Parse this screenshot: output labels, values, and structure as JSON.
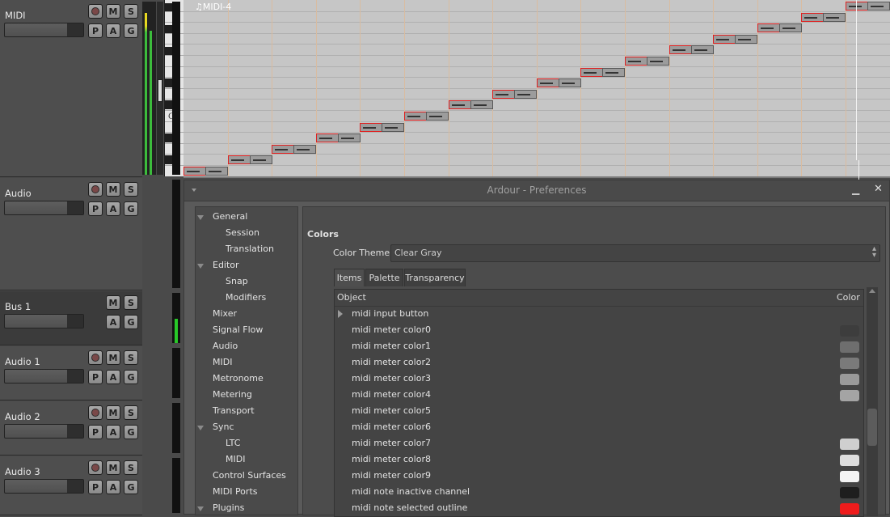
{
  "tracks": [
    {
      "name": "MIDI",
      "type": "midi",
      "buttons_top": [
        "M",
        "S"
      ],
      "buttons_bottom": [
        "P",
        "A",
        "G"
      ],
      "rec": true
    },
    {
      "name": "Audio",
      "type": "audio",
      "buttons_top": [
        "M",
        "S"
      ],
      "buttons_bottom": [
        "P",
        "A",
        "G"
      ],
      "rec": true
    },
    {
      "name": "Bus 1",
      "type": "bus",
      "buttons_top": [
        "M",
        "S"
      ],
      "buttons_bottom": [
        "A",
        "G"
      ],
      "rec": false
    },
    {
      "name": "Audio 1",
      "type": "audio",
      "buttons_top": [
        "M",
        "S"
      ],
      "buttons_bottom": [
        "P",
        "A",
        "G"
      ],
      "rec": true
    },
    {
      "name": "Audio 2",
      "type": "audio",
      "buttons_top": [
        "M",
        "S"
      ],
      "buttons_bottom": [
        "P",
        "A",
        "G"
      ],
      "rec": true
    },
    {
      "name": "Audio 3",
      "type": "audio",
      "buttons_top": [
        "M",
        "S"
      ],
      "buttons_bottom": [
        "P",
        "A",
        "G"
      ],
      "rec": true
    }
  ],
  "piano_roll": {
    "region_name": "♫MIDI-4",
    "key_label": "C4",
    "note_count": 16
  },
  "dialog": {
    "title": "Ardour - Preferences",
    "minimize_glyph": "▁",
    "close_glyph": "✕",
    "sidebar": [
      {
        "label": "General",
        "level": 0,
        "expanded": true
      },
      {
        "label": "Session",
        "level": 1
      },
      {
        "label": "Translation",
        "level": 1
      },
      {
        "label": "Editor",
        "level": 0,
        "expanded": true
      },
      {
        "label": "Snap",
        "level": 1
      },
      {
        "label": "Modifiers",
        "level": 1
      },
      {
        "label": "Mixer",
        "level": 0
      },
      {
        "label": "Signal Flow",
        "level": 0
      },
      {
        "label": "Audio",
        "level": 0
      },
      {
        "label": "MIDI",
        "level": 0
      },
      {
        "label": "Metronome",
        "level": 0
      },
      {
        "label": "Metering",
        "level": 0
      },
      {
        "label": "Transport",
        "level": 0
      },
      {
        "label": "Sync",
        "level": 0,
        "expanded": true
      },
      {
        "label": "LTC",
        "level": 1
      },
      {
        "label": "MIDI",
        "level": 1
      },
      {
        "label": "Control Surfaces",
        "level": 0
      },
      {
        "label": "MIDI Ports",
        "level": 0
      },
      {
        "label": "Plugins",
        "level": 0,
        "expanded": true
      }
    ],
    "section_title": "Colors",
    "theme_label": "Color Theme",
    "theme_value": "Clear Gray",
    "tabs": [
      "Items",
      "Palette",
      "Transparency"
    ],
    "active_tab": "Items",
    "list_header": {
      "object": "Object",
      "color": "Color"
    },
    "rows": [
      {
        "name": "midi input button",
        "color": null,
        "expandable": true
      },
      {
        "name": "midi meter color0",
        "color": "#3d3d3d"
      },
      {
        "name": "midi meter color1",
        "color": "#6e6e6e"
      },
      {
        "name": "midi meter color2",
        "color": "#7a7a7a"
      },
      {
        "name": "midi meter color3",
        "color": "#9a9a9a"
      },
      {
        "name": "midi meter color4",
        "color": "#a4a4a4"
      },
      {
        "name": "midi meter color5",
        "color": null
      },
      {
        "name": "midi meter color6",
        "color": null
      },
      {
        "name": "midi meter color7",
        "color": "#cfcfcf"
      },
      {
        "name": "midi meter color8",
        "color": "#dedede"
      },
      {
        "name": "midi meter color9",
        "color": "#f4f4f4"
      },
      {
        "name": "midi note inactive channel",
        "color": "#1e1e1e"
      },
      {
        "name": "midi note selected outline",
        "color": "#ee1c1c"
      }
    ]
  }
}
